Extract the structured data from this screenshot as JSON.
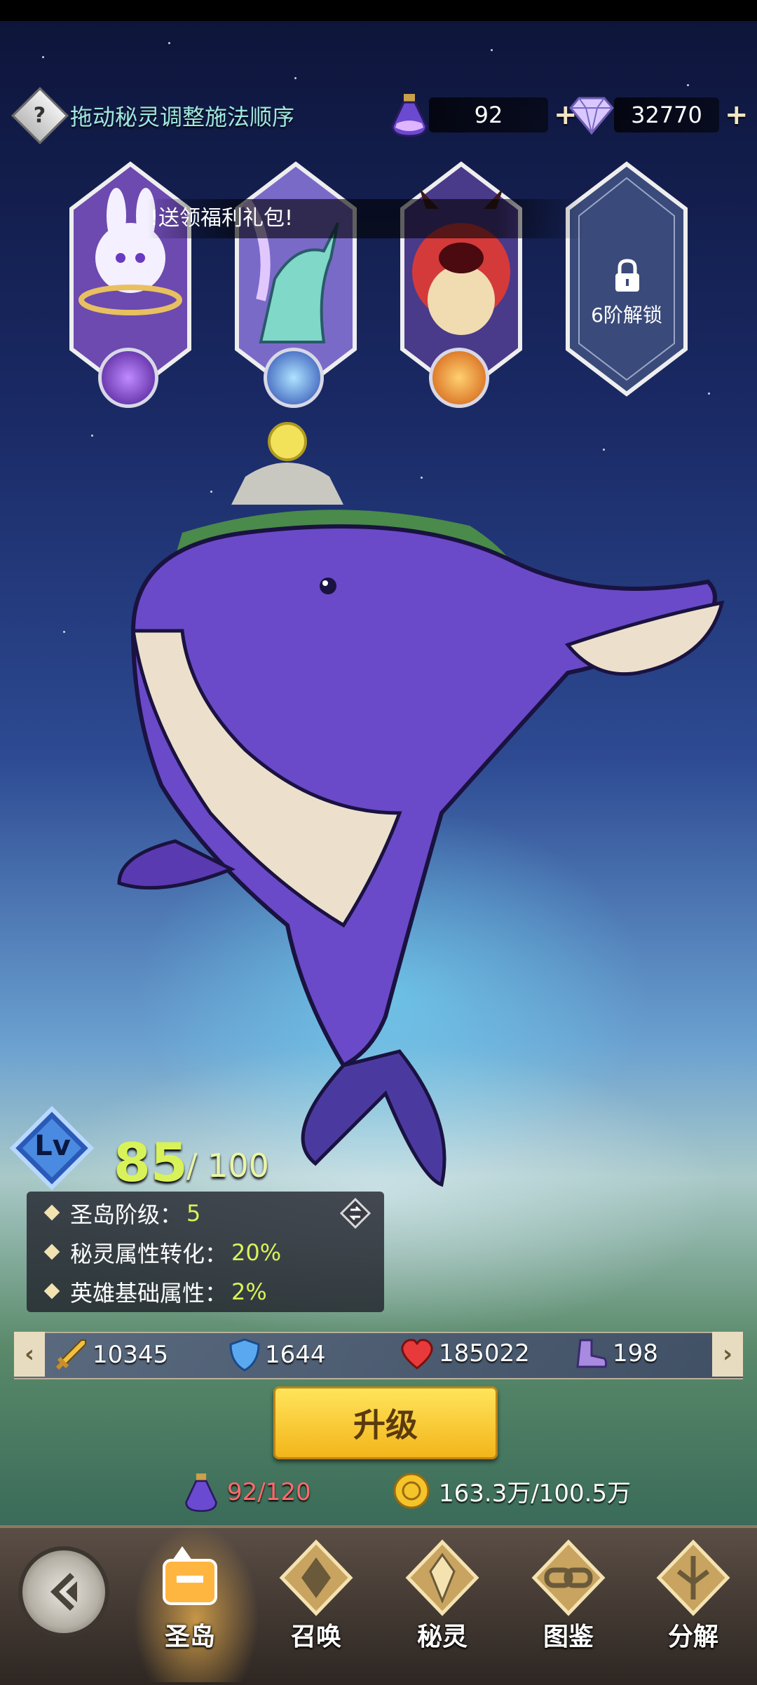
{
  "top": {
    "hint_text": "拖动秘灵调整施法顺序",
    "potion_count": "92",
    "gem_count": "32770",
    "plus": "+"
  },
  "slots": {
    "banner_text": "!送领福利礼包!",
    "locked_label": "6阶解锁"
  },
  "level": {
    "badge": "Lv",
    "current": "85",
    "max": "/ 100"
  },
  "stats": [
    {
      "label": "圣岛阶级：",
      "value": "5"
    },
    {
      "label": "秘灵属性转化：",
      "value": "20%"
    },
    {
      "label": "英雄基础属性：",
      "value": "2%"
    }
  ],
  "attributes": {
    "attack": "10345",
    "defense": "1644",
    "hp": "185022",
    "speed": "198"
  },
  "upgrade_label": "升级",
  "costs": {
    "potion": "92/120",
    "gold": "163.3万/100.5万"
  },
  "nav": [
    {
      "label": "圣岛"
    },
    {
      "label": "召唤"
    },
    {
      "label": "秘灵"
    },
    {
      "label": "图鉴"
    },
    {
      "label": "分解"
    }
  ],
  "colors": {
    "accent_green": "#d8f25a",
    "cost_red": "#ff6a6a",
    "upgrade_yellow": "#f3c51b"
  }
}
